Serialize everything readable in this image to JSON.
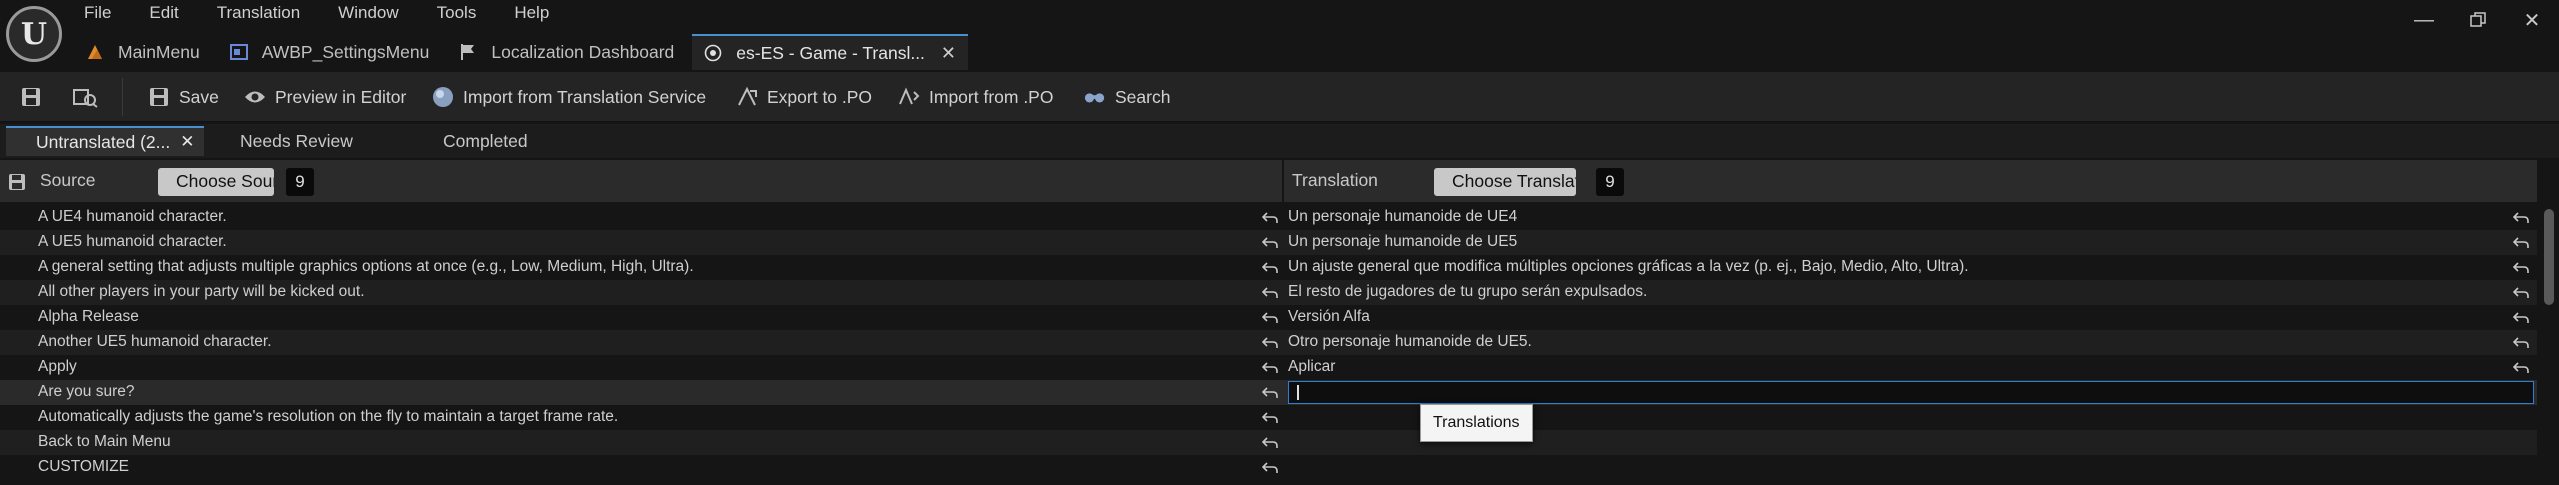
{
  "menu": [
    "File",
    "Edit",
    "Translation",
    "Window",
    "Tools",
    "Help"
  ],
  "doc_tabs": [
    {
      "label": "MainMenu",
      "icon": "level-icon"
    },
    {
      "label": "AWBP_SettingsMenu",
      "icon": "widget-blueprint-icon"
    },
    {
      "label": "Localization Dashboard",
      "icon": "flag-icon"
    },
    {
      "label": "es-ES - Game - Transl...",
      "icon": "globe-icon"
    }
  ],
  "toolbar": {
    "save": "Save",
    "preview": "Preview in Editor",
    "import_service": "Import from Translation Service",
    "export_po": "Export to .PO",
    "import_po": "Import from .PO",
    "search": "Search"
  },
  "filter_tabs": {
    "untranslated": "Untranslated (2...",
    "needs_review": "Needs Review",
    "completed": "Completed"
  },
  "source_header": {
    "label": "Source",
    "choose": "Choose Source Font",
    "count": "9"
  },
  "translation_header": {
    "label": "Translation",
    "choose": "Choose Translation Font",
    "count": "9"
  },
  "rows": [
    {
      "source": "A UE4 humanoid character.",
      "translation": "Un personaje humanoide de UE4"
    },
    {
      "source": "A UE5 humanoid character.",
      "translation": "Un personaje humanoide de UE5"
    },
    {
      "source": "A general setting that adjusts multiple graphics options at once (e.g., Low, Medium, High, Ultra).",
      "translation": "Un ajuste general que modifica múltiples opciones gráficas a la vez (p. ej., Bajo, Medio, Alto, Ultra)."
    },
    {
      "source": "All other players in your party will be kicked out.",
      "translation": "El resto de jugadores de tu grupo serán expulsados."
    },
    {
      "source": "Alpha Release",
      "translation": "Versión Alfa"
    },
    {
      "source": "Another UE5 humanoid character.",
      "translation": "Otro personaje humanoide de UE5."
    },
    {
      "source": "Apply",
      "translation": "Aplicar"
    },
    {
      "source": "Are you sure?",
      "translation": ""
    },
    {
      "source": "Automatically adjusts the game's resolution on the fly to maintain a target frame rate.",
      "translation": ""
    },
    {
      "source": "Back to Main Menu",
      "translation": ""
    },
    {
      "source": "CUSTOMIZE",
      "translation": ""
    }
  ],
  "tooltip": "Translations",
  "colors": {
    "accent": "#2d7fd4",
    "bg": "#151515",
    "panel": "#242424"
  }
}
